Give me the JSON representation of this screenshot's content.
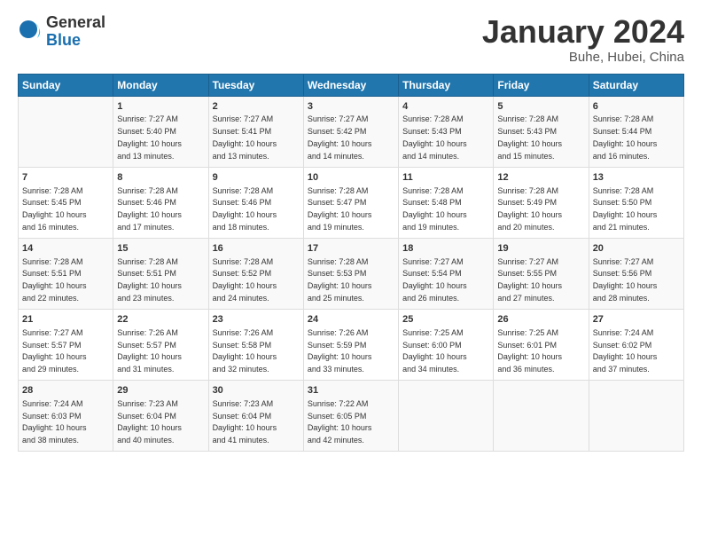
{
  "logo": {
    "general": "General",
    "blue": "Blue"
  },
  "header": {
    "month": "January 2024",
    "location": "Buhe, Hubei, China"
  },
  "weekdays": [
    "Sunday",
    "Monday",
    "Tuesday",
    "Wednesday",
    "Thursday",
    "Friday",
    "Saturday"
  ],
  "rows": [
    [
      {
        "day": "",
        "sunrise": "",
        "sunset": "",
        "daylight": ""
      },
      {
        "day": "1",
        "sunrise": "7:27 AM",
        "sunset": "5:40 PM",
        "daylight": "10 hours and 13 minutes."
      },
      {
        "day": "2",
        "sunrise": "7:27 AM",
        "sunset": "5:41 PM",
        "daylight": "10 hours and 13 minutes."
      },
      {
        "day": "3",
        "sunrise": "7:27 AM",
        "sunset": "5:42 PM",
        "daylight": "10 hours and 14 minutes."
      },
      {
        "day": "4",
        "sunrise": "7:28 AM",
        "sunset": "5:43 PM",
        "daylight": "10 hours and 14 minutes."
      },
      {
        "day": "5",
        "sunrise": "7:28 AM",
        "sunset": "5:43 PM",
        "daylight": "10 hours and 15 minutes."
      },
      {
        "day": "6",
        "sunrise": "7:28 AM",
        "sunset": "5:44 PM",
        "daylight": "10 hours and 16 minutes."
      }
    ],
    [
      {
        "day": "7",
        "sunrise": "7:28 AM",
        "sunset": "5:45 PM",
        "daylight": "10 hours and 16 minutes."
      },
      {
        "day": "8",
        "sunrise": "7:28 AM",
        "sunset": "5:46 PM",
        "daylight": "10 hours and 17 minutes."
      },
      {
        "day": "9",
        "sunrise": "7:28 AM",
        "sunset": "5:46 PM",
        "daylight": "10 hours and 18 minutes."
      },
      {
        "day": "10",
        "sunrise": "7:28 AM",
        "sunset": "5:47 PM",
        "daylight": "10 hours and 19 minutes."
      },
      {
        "day": "11",
        "sunrise": "7:28 AM",
        "sunset": "5:48 PM",
        "daylight": "10 hours and 19 minutes."
      },
      {
        "day": "12",
        "sunrise": "7:28 AM",
        "sunset": "5:49 PM",
        "daylight": "10 hours and 20 minutes."
      },
      {
        "day": "13",
        "sunrise": "7:28 AM",
        "sunset": "5:50 PM",
        "daylight": "10 hours and 21 minutes."
      }
    ],
    [
      {
        "day": "14",
        "sunrise": "7:28 AM",
        "sunset": "5:51 PM",
        "daylight": "10 hours and 22 minutes."
      },
      {
        "day": "15",
        "sunrise": "7:28 AM",
        "sunset": "5:51 PM",
        "daylight": "10 hours and 23 minutes."
      },
      {
        "day": "16",
        "sunrise": "7:28 AM",
        "sunset": "5:52 PM",
        "daylight": "10 hours and 24 minutes."
      },
      {
        "day": "17",
        "sunrise": "7:28 AM",
        "sunset": "5:53 PM",
        "daylight": "10 hours and 25 minutes."
      },
      {
        "day": "18",
        "sunrise": "7:27 AM",
        "sunset": "5:54 PM",
        "daylight": "10 hours and 26 minutes."
      },
      {
        "day": "19",
        "sunrise": "7:27 AM",
        "sunset": "5:55 PM",
        "daylight": "10 hours and 27 minutes."
      },
      {
        "day": "20",
        "sunrise": "7:27 AM",
        "sunset": "5:56 PM",
        "daylight": "10 hours and 28 minutes."
      }
    ],
    [
      {
        "day": "21",
        "sunrise": "7:27 AM",
        "sunset": "5:57 PM",
        "daylight": "10 hours and 29 minutes."
      },
      {
        "day": "22",
        "sunrise": "7:26 AM",
        "sunset": "5:57 PM",
        "daylight": "10 hours and 31 minutes."
      },
      {
        "day": "23",
        "sunrise": "7:26 AM",
        "sunset": "5:58 PM",
        "daylight": "10 hours and 32 minutes."
      },
      {
        "day": "24",
        "sunrise": "7:26 AM",
        "sunset": "5:59 PM",
        "daylight": "10 hours and 33 minutes."
      },
      {
        "day": "25",
        "sunrise": "7:25 AM",
        "sunset": "6:00 PM",
        "daylight": "10 hours and 34 minutes."
      },
      {
        "day": "26",
        "sunrise": "7:25 AM",
        "sunset": "6:01 PM",
        "daylight": "10 hours and 36 minutes."
      },
      {
        "day": "27",
        "sunrise": "7:24 AM",
        "sunset": "6:02 PM",
        "daylight": "10 hours and 37 minutes."
      }
    ],
    [
      {
        "day": "28",
        "sunrise": "7:24 AM",
        "sunset": "6:03 PM",
        "daylight": "10 hours and 38 minutes."
      },
      {
        "day": "29",
        "sunrise": "7:23 AM",
        "sunset": "6:04 PM",
        "daylight": "10 hours and 40 minutes."
      },
      {
        "day": "30",
        "sunrise": "7:23 AM",
        "sunset": "6:04 PM",
        "daylight": "10 hours and 41 minutes."
      },
      {
        "day": "31",
        "sunrise": "7:22 AM",
        "sunset": "6:05 PM",
        "daylight": "10 hours and 42 minutes."
      },
      {
        "day": "",
        "sunrise": "",
        "sunset": "",
        "daylight": ""
      },
      {
        "day": "",
        "sunrise": "",
        "sunset": "",
        "daylight": ""
      },
      {
        "day": "",
        "sunrise": "",
        "sunset": "",
        "daylight": ""
      }
    ]
  ],
  "labels": {
    "sunrise": "Sunrise:",
    "sunset": "Sunset:",
    "daylight": "Daylight:"
  }
}
